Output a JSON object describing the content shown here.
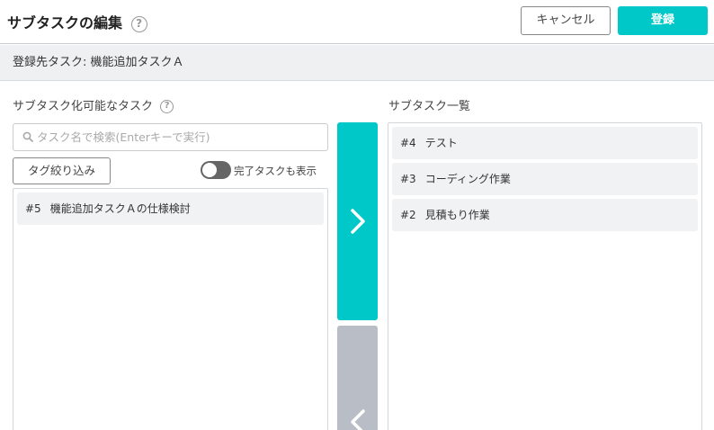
{
  "header": {
    "title": "サブタスクの編集",
    "help_glyph": "?",
    "cancel_label": "キャンセル",
    "submit_label": "登録"
  },
  "target": {
    "label": "登録先タスク: 機能追加タスクＡ"
  },
  "left_panel": {
    "heading": "サブタスク化可能なタスク",
    "help_glyph": "?",
    "search_placeholder": "タスク名で検索(Enterキーで実行)",
    "tag_filter_label": "タグ絞り込み",
    "show_completed_label": "完了タスクも表示",
    "show_completed": false,
    "items": [
      {
        "num": "#5",
        "name": "機能追加タスクＡの仕様検討"
      }
    ]
  },
  "right_panel": {
    "heading": "サブタスク一覧",
    "items": [
      {
        "num": "#4",
        "name": "テスト"
      },
      {
        "num": "#3",
        "name": "コーディング作業"
      },
      {
        "num": "#2",
        "name": "見積もり作業"
      }
    ]
  },
  "colors": {
    "accent": "#00c8c8",
    "disabled": "#b9bec6"
  },
  "icons": {
    "move_right": "chevron-right-icon",
    "move_left": "chevron-left-icon",
    "search": "search-icon",
    "help": "help-icon"
  }
}
